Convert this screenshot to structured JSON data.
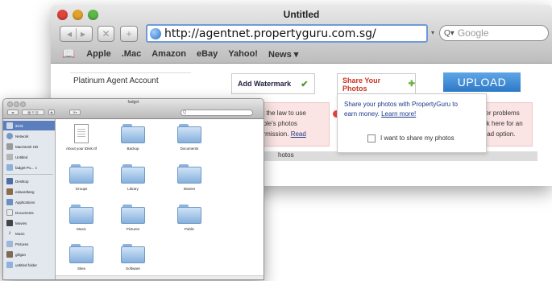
{
  "browser": {
    "title": "Untitled",
    "nav": {
      "back": "◀",
      "forward": "▶",
      "stop": "✕",
      "add": "+"
    },
    "url": "http://agentnet.propertyguru.com.sg/",
    "search_placeholder": "Google",
    "bookmarks": [
      "Apple",
      ".Mac",
      "Amazon",
      "eBay",
      "Yahoo!",
      "News ▾"
    ]
  },
  "page": {
    "account_label": "Platinum Agent Account",
    "add_watermark": "Add Watermark",
    "share_photos": "Share Your Photos",
    "upload": "UPLOAD",
    "warning_left": [
      "st the law to use",
      "ople's photos",
      "ermission."
    ],
    "warning_left_link": "Read",
    "warning_right": [
      "der problems",
      "ick here for an",
      "load option."
    ],
    "warning_right_link": "ck here",
    "photos_header": "hotos",
    "popup": {
      "text1": "Share your photos with PropertyGuru to",
      "text2": "earn money.",
      "link": "Learn more!",
      "checkbox_label": "I want to share my photos"
    }
  },
  "finder": {
    "title": "fadget",
    "search_value": "Q",
    "sidebar": [
      {
        "label": "iDisk",
        "icon": "idisk-icon",
        "selected": true
      },
      {
        "label": "Network",
        "icon": "network-icon"
      },
      {
        "label": "Macintosh HD",
        "icon": "harddisk-icon"
      },
      {
        "label": "Untitled",
        "icon": "disk-icon"
      },
      {
        "label": "fadget-Pu... ≡",
        "icon": "disk-icon"
      },
      {
        "label": "Desktop",
        "icon": "desktop-icon"
      },
      {
        "label": "edwardtang",
        "icon": "home-icon"
      },
      {
        "label": "Applications",
        "icon": "applications-icon"
      },
      {
        "label": "Documents",
        "icon": "documents-icon"
      },
      {
        "label": "Movies",
        "icon": "movies-icon"
      },
      {
        "label": "Music",
        "icon": "music-icon"
      },
      {
        "label": "Pictures",
        "icon": "pictures-icon"
      },
      {
        "label": "gillgan",
        "icon": "user-icon"
      },
      {
        "label": "untitled folder",
        "icon": "folder-icon"
      }
    ],
    "items": [
      {
        "label": "About your iDisk.rtf",
        "type": "doc"
      },
      {
        "label": "Backup",
        "type": "folder"
      },
      {
        "label": "Documents",
        "type": "folder"
      },
      {
        "label": "Groups",
        "type": "folder"
      },
      {
        "label": "Library",
        "type": "folder"
      },
      {
        "label": "Movies",
        "type": "folder"
      },
      {
        "label": "Music",
        "type": "folder"
      },
      {
        "label": "Pictures",
        "type": "folder"
      },
      {
        "label": "Public",
        "type": "folder"
      },
      {
        "label": "Sites",
        "type": "folder"
      },
      {
        "label": "Software",
        "type": "folder"
      }
    ]
  },
  "colors": {
    "upload": "#2d78c8",
    "share_text": "#cc3322",
    "selected": "#5b7fbd"
  }
}
